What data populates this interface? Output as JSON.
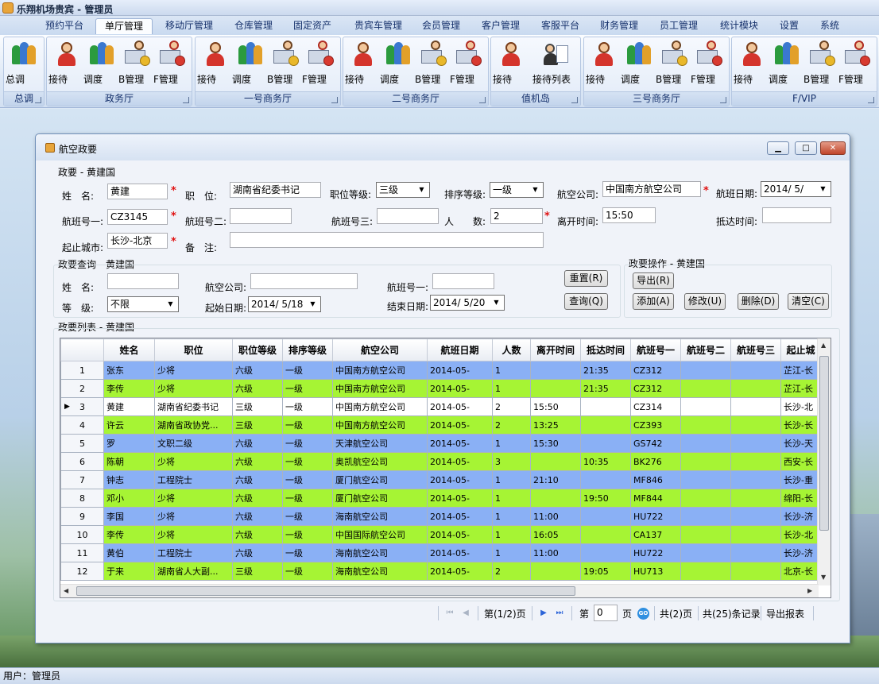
{
  "app": {
    "title": "乐翔机场贵宾 - 管理员"
  },
  "menu": {
    "tabs": [
      "预约平台",
      "单厅管理",
      "移动厅管理",
      "仓库管理",
      "固定资产",
      "贵宾车管理",
      "会员管理",
      "客户管理",
      "客服平台",
      "财务管理",
      "员工管理",
      "统计模块",
      "设置",
      "系统"
    ],
    "active": "单厅管理"
  },
  "ribbon": {
    "groups": [
      {
        "label": "总调",
        "buttons": [
          "总调"
        ]
      },
      {
        "label": "政务厅",
        "buttons": [
          "接待",
          "调度",
          "B管理",
          "F管理"
        ]
      },
      {
        "label": "一号商务厅",
        "buttons": [
          "接待",
          "调度",
          "B管理",
          "F管理"
        ]
      },
      {
        "label": "二号商务厅",
        "buttons": [
          "接待",
          "调度",
          "B管理",
          "F管理"
        ]
      },
      {
        "label": "值机岛",
        "buttons": [
          "接待",
          "接待列表"
        ]
      },
      {
        "label": "三号商务厅",
        "buttons": [
          "接待",
          "调度",
          "B管理",
          "F管理"
        ]
      },
      {
        "label": "F/VIP",
        "buttons": [
          "接待",
          "调度",
          "B管理",
          "F管理"
        ]
      }
    ]
  },
  "window": {
    "title": "航空政要",
    "btn_min": "▁",
    "btn_max": "□",
    "btn_close": "✕"
  },
  "form": {
    "section": "政要 - 黄建国",
    "name_label": "姓　名:",
    "name_value": "黄建",
    "position_label": "职　位:",
    "position_value": "湖南省纪委书记",
    "rank_label": "职位等级:",
    "rank_value": "三级",
    "sort_label": "排序等级:",
    "sort_value": "一级",
    "airline_label": "航空公司:",
    "airline_value": "中国南方航空公司",
    "date_label": "航班日期:",
    "date_value": "2014/ 5/",
    "flight1_label": "航班号一:",
    "flight1_value": "CZ3145",
    "flight2_label": "航班号二:",
    "flight2_value": "",
    "flight3_label": "航班号三:",
    "flight3_value": "",
    "people_label": "人　　数:",
    "people_value": "2",
    "depart_label": "离开时间:",
    "depart_value": "15:50",
    "arrive_label": "抵达时间:",
    "arrive_value": "",
    "city_label": "起止城市:",
    "city_value": "长沙-北京",
    "note_label": "备　注:",
    "note_value": "",
    "required_mark": "*"
  },
  "query": {
    "section": "政要查询 - 黄建国",
    "name_label": "姓　名:",
    "name_value": "",
    "airline_label": "航空公司:",
    "airline_value": "",
    "flight_label": "航班号一:",
    "flight_value": "",
    "level_label": "等　级:",
    "level_value": "不限",
    "start_label": "起始日期:",
    "start_value": "2014/ 5/18",
    "end_label": "结束日期:",
    "end_value": "2014/ 5/20",
    "reset_button": "重置(R)",
    "query_button": "查询(Q)"
  },
  "ops": {
    "section": "政要操作 - 黄建国",
    "export_button": "导出(R)",
    "add_button": "添加(A)",
    "edit_button": "修改(U)",
    "delete_button": "删除(D)",
    "clear_button": "清空(C)"
  },
  "list": {
    "section": "政要列表 - 黄建国",
    "columns": [
      "姓名",
      "职位",
      "职位等级",
      "排序等级",
      "航空公司",
      "航班日期",
      "人数",
      "离开时间",
      "抵达时间",
      "航班号一",
      "航班号二",
      "航班号三",
      "起止城"
    ],
    "rows": [
      {
        "no": "1",
        "color": "blue",
        "cells": [
          "张东",
          "少将",
          "六级",
          "一级",
          "中国南方航空公司",
          "2014-05-",
          "1",
          "",
          "21:35",
          "CZ312",
          "",
          "",
          "芷江-长"
        ]
      },
      {
        "no": "2",
        "color": "green",
        "cells": [
          "李传",
          "少将",
          "六级",
          "一级",
          "中国南方航空公司",
          "2014-05-",
          "1",
          "",
          "21:35",
          "CZ312",
          "",
          "",
          "芷江-长"
        ]
      },
      {
        "no": "3",
        "color": "white",
        "cells": [
          "黄建",
          "湖南省纪委书记",
          "三级",
          "一级",
          "中国南方航空公司",
          "2014-05-",
          "2",
          "15:50",
          "",
          "CZ314",
          "",
          "",
          "长沙-北"
        ]
      },
      {
        "no": "4",
        "color": "green",
        "cells": [
          "许云",
          "湖南省政协党...",
          "三级",
          "一级",
          "中国南方航空公司",
          "2014-05-",
          "2",
          "13:25",
          "",
          "CZ393",
          "",
          "",
          "长沙-长"
        ]
      },
      {
        "no": "5",
        "color": "blue",
        "cells": [
          "罗",
          "文职二级",
          "六级",
          "一级",
          "天津航空公司",
          "2014-05-",
          "1",
          "15:30",
          "",
          "GS742",
          "",
          "",
          "长沙-天"
        ]
      },
      {
        "no": "6",
        "color": "green",
        "cells": [
          "陈朝",
          "少将",
          "六级",
          "一级",
          "奥凯航空公司",
          "2014-05-",
          "3",
          "",
          "10:35",
          "BK276",
          "",
          "",
          "西安-长"
        ]
      },
      {
        "no": "7",
        "color": "blue",
        "cells": [
          "钟志",
          "工程院士",
          "六级",
          "一级",
          "厦门航空公司",
          "2014-05-",
          "1",
          "21:10",
          "",
          "MF846",
          "",
          "",
          "长沙-重"
        ]
      },
      {
        "no": "8",
        "color": "green",
        "cells": [
          "邓小",
          "少将",
          "六级",
          "一级",
          "厦门航空公司",
          "2014-05-",
          "1",
          "",
          "19:50",
          "MF844",
          "",
          "",
          "绵阳-长"
        ]
      },
      {
        "no": "9",
        "color": "blue",
        "cells": [
          "李国",
          "少将",
          "六级",
          "一级",
          "海南航空公司",
          "2014-05-",
          "1",
          "11:00",
          "",
          "HU722",
          "",
          "",
          "长沙-济"
        ]
      },
      {
        "no": "10",
        "color": "green",
        "cells": [
          "李传",
          "少将",
          "六级",
          "一级",
          "中国国际航空公司",
          "2014-05-",
          "1",
          "16:05",
          "",
          "CA137",
          "",
          "",
          "长沙-北"
        ]
      },
      {
        "no": "11",
        "color": "blue",
        "cells": [
          "黄伯",
          "工程院士",
          "六级",
          "一级",
          "海南航空公司",
          "2014-05-",
          "1",
          "11:00",
          "",
          "HU722",
          "",
          "",
          "长沙-济"
        ]
      },
      {
        "no": "12",
        "color": "green",
        "cells": [
          "于来",
          "湖南省人大副...",
          "三级",
          "一级",
          "海南航空公司",
          "2014-05-",
          "2",
          "",
          "19:05",
          "HU713",
          "",
          "",
          "北京-长"
        ]
      }
    ],
    "selected_row": "3"
  },
  "pager": {
    "page_info": "第(1/2)页",
    "page_label": "第",
    "page_value": "0",
    "page_unit": "页",
    "go_label": "GO",
    "total_pages": "共(2)页",
    "total_records": "共(25)条记录",
    "export_report": "导出报表"
  },
  "status": {
    "user": "用户：管理员"
  }
}
